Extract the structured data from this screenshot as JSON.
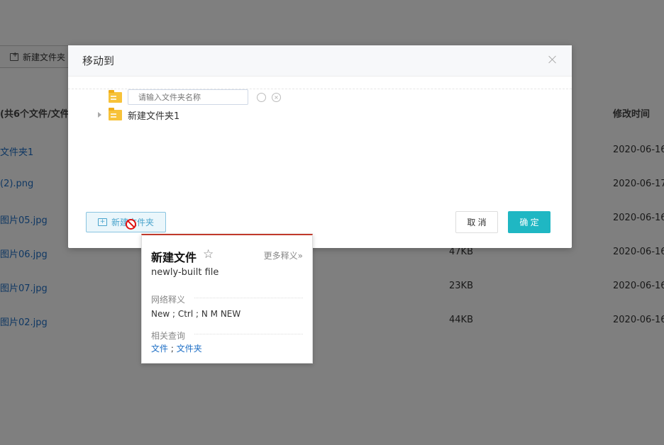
{
  "background": {
    "new_folder_btn": "新建文件夹",
    "header_name": "(共6个文件/文件",
    "header_time": "修改时间",
    "rows": [
      {
        "name": "文件夹1",
        "size": "",
        "time": "2020-06-16"
      },
      {
        "name": "(2).png",
        "size": "",
        "time": "2020-06-17"
      },
      {
        "name": "图片05.jpg",
        "size": "",
        "time": "2020-06-16"
      },
      {
        "name": "图片06.jpg",
        "size": "47KB",
        "time": "2020-06-16"
      },
      {
        "name": "图片07.jpg",
        "size": "23KB",
        "time": "2020-06-16"
      },
      {
        "name": "图片02.jpg",
        "size": "44KB",
        "time": "2020-06-16"
      }
    ]
  },
  "dialog": {
    "title": "移动到",
    "input_placeholder": "请输入文件夹名称",
    "tree": [
      {
        "label": "新建文件夹1"
      }
    ],
    "new_folder_label": "新建文件夹",
    "cancel": "取 消",
    "confirm": "确 定"
  },
  "dictionary": {
    "word": "新建文件",
    "more": "更多释义»",
    "translation": "newly-built file",
    "web_title": "网络释义",
    "web_text": "New ; Ctrl ; N M NEW",
    "related_title": "相关查询",
    "related": [
      "文件",
      "文件夹"
    ],
    "separator": " ; "
  },
  "colors": {
    "accent": "#1fb7c3",
    "link": "#1e6fc6",
    "folder": "#f7c23a",
    "dict_border": "#c0392b"
  }
}
